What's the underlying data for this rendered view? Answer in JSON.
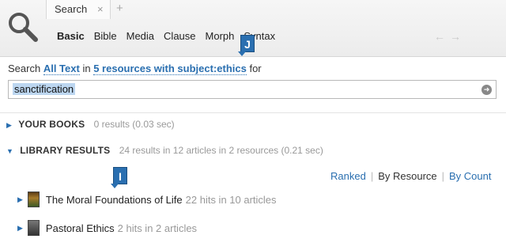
{
  "tab": {
    "label": "Search",
    "close": "×",
    "add": "+"
  },
  "nav": [
    "Basic",
    "Bible",
    "Media",
    "Clause",
    "Morph",
    "Syntax"
  ],
  "arrows": {
    "back": "←",
    "forward": "→"
  },
  "badges": {
    "j": "J",
    "i": "I"
  },
  "query": {
    "prefix": "Search",
    "scope": "All Text",
    "middle": "in",
    "resources": "5 resources with subject:ethics",
    "suffix": "for"
  },
  "search": {
    "value": "sanctification"
  },
  "sections": {
    "books": {
      "label": "YOUR BOOKS",
      "meta": "0 results (0.03 sec)"
    },
    "library": {
      "label": "LIBRARY RESULTS",
      "meta": "24 results in 12 articles in 2 resources (0.21 sec)"
    }
  },
  "sort": {
    "ranked": "Ranked",
    "by_resource": "By Resource",
    "by_count": "By Count"
  },
  "results": [
    {
      "title": "The Moral Foundations of Life",
      "hits": "22 hits in 10 articles"
    },
    {
      "title": "Pastoral Ethics",
      "hits": "2 hits in 2 articles"
    }
  ],
  "colors": {
    "accent": "#2a6fb0",
    "muted": "#999999"
  }
}
